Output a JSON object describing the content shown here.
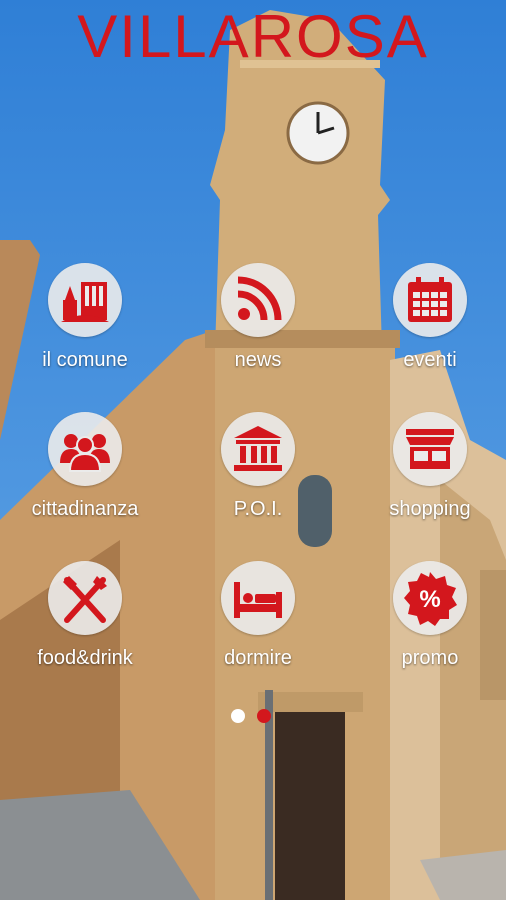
{
  "app": {
    "title": "VILLAROSA"
  },
  "colors": {
    "brand_red": "#d3171d",
    "circle_bg": "#ebebeb",
    "label": "#ffffff"
  },
  "menu": [
    {
      "label": "il comune",
      "icon": "town-hall-icon"
    },
    {
      "label": "news",
      "icon": "rss-icon"
    },
    {
      "label": "eventi",
      "icon": "calendar-icon"
    },
    {
      "label": "cittadinanza",
      "icon": "people-icon"
    },
    {
      "label": "P.O.I.",
      "icon": "monument-icon"
    },
    {
      "label": "shopping",
      "icon": "shop-icon"
    },
    {
      "label": "food&drink",
      "icon": "fork-knife-icon"
    },
    {
      "label": "dormire",
      "icon": "bed-icon"
    },
    {
      "label": "promo",
      "icon": "percent-badge-icon"
    }
  ],
  "pager": {
    "current_page": 1,
    "pages": 2
  }
}
